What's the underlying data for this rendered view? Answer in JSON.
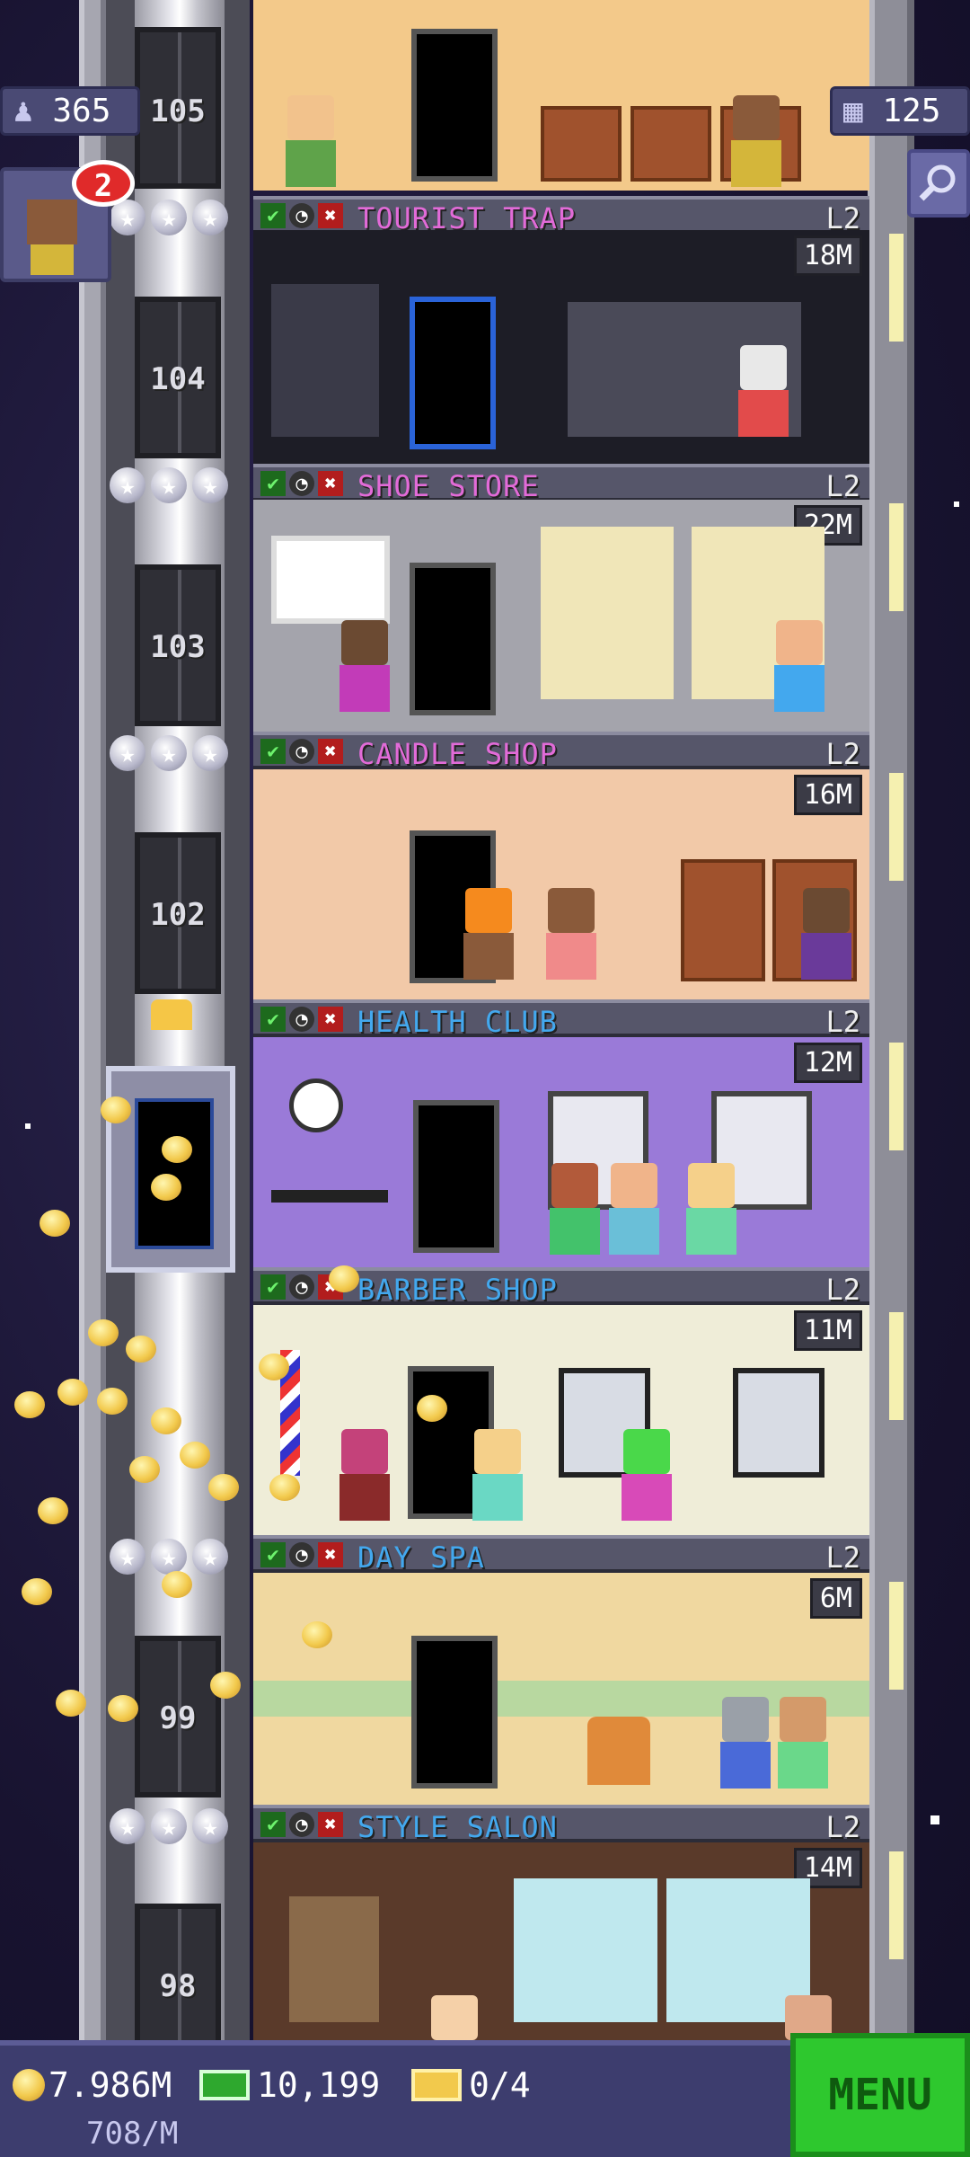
{
  "hud": {
    "population": "365",
    "floors_count": "125",
    "visitor_badge": "2"
  },
  "floors": [
    {
      "number": "105",
      "name": "TOURIST TRAP",
      "level": "L2",
      "price": "",
      "name_color": "#e26bd8"
    },
    {
      "number": "104",
      "name": "SHOE STORE",
      "level": "L2",
      "price": "18M",
      "name_color": "#e26bd8"
    },
    {
      "number": "103",
      "name": "CANDLE SHOP",
      "level": "L2",
      "price": "22M",
      "name_color": "#e26bd8"
    },
    {
      "number": "102",
      "name": "HEALTH CLUB",
      "level": "L2",
      "price": "16M",
      "name_color": "#43a8ee"
    },
    {
      "number": "",
      "name": "BARBER SHOP",
      "level": "L2",
      "price": "12M",
      "name_color": "#43a8ee"
    },
    {
      "number": "",
      "name": "DAY SPA",
      "level": "L2",
      "price": "11M",
      "name_color": "#43a8ee"
    },
    {
      "number": "99",
      "name": "STYLE SALON",
      "level": "L2",
      "price": "6M",
      "name_color": "#43a8ee"
    },
    {
      "number": "98",
      "name": "",
      "level": "",
      "price": "14M",
      "name_color": "#43a8ee"
    }
  ],
  "bottom": {
    "coins": "7.986M",
    "coin_rate": "708/M",
    "bux": "10,199",
    "tickets": "0/4",
    "menu_label": "MENU"
  },
  "icons": {
    "check": "✔",
    "clock": "◔",
    "x": "✖",
    "star": "★",
    "person": "♟",
    "grid": "▦"
  },
  "colors": {
    "menu_green": "#2ec82e",
    "hud_purple": "#4a4a74",
    "coin_gold": "#f2c94c"
  }
}
